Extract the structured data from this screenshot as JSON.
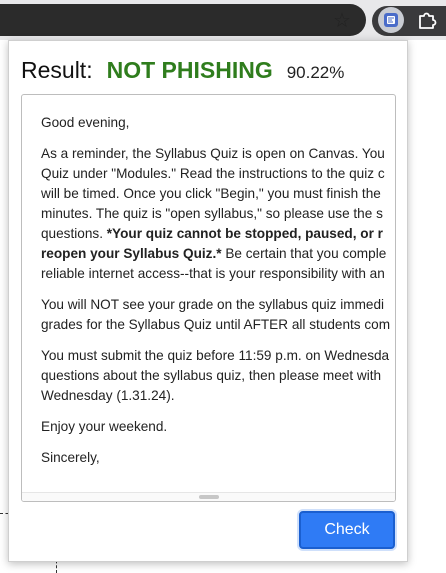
{
  "browser": {
    "bookmark_icon": "star-outline-icon",
    "extension_icon": "phishing-detector-extension-icon",
    "extensions_menu_icon": "puzzle-piece-icon",
    "star_glyph": "☆"
  },
  "popup": {
    "result_label": "Result:",
    "verdict": "NOT PHISHING",
    "score": "90.22%",
    "verdict_color": "#2f7d1d",
    "email_paragraphs": [
      [
        "Good evening,"
      ],
      [
        "As a reminder, the Syllabus Quiz is open on Canvas.  You",
        "Quiz under \"Modules.\"  Read the instructions to the quiz c",
        "will be timed.  Once you click \"Begin,\" you must finish the",
        "minutes.   The quiz is \"open syllabus,\" so please use the s",
        "questions.  *Your quiz cannot be stopped, paused, or r",
        "reopen your Syllabus Quiz.*  Be certain that you comple",
        "reliable internet access--that is your responsibility with an"
      ],
      [
        "You will NOT see your grade on the syllabus quiz immedi",
        "grades for the Syllabus Quiz until AFTER all students com"
      ],
      [
        "You must submit the quiz before 11:59 p.m. on Wednesda",
        "questions about the syllabus quiz, then please meet with",
        "Wednesday (1.31.24)."
      ],
      [
        "Enjoy your weekend."
      ],
      [
        "Sincerely,"
      ]
    ],
    "check_label": "Check",
    "button_color": "#2f7bf5"
  }
}
